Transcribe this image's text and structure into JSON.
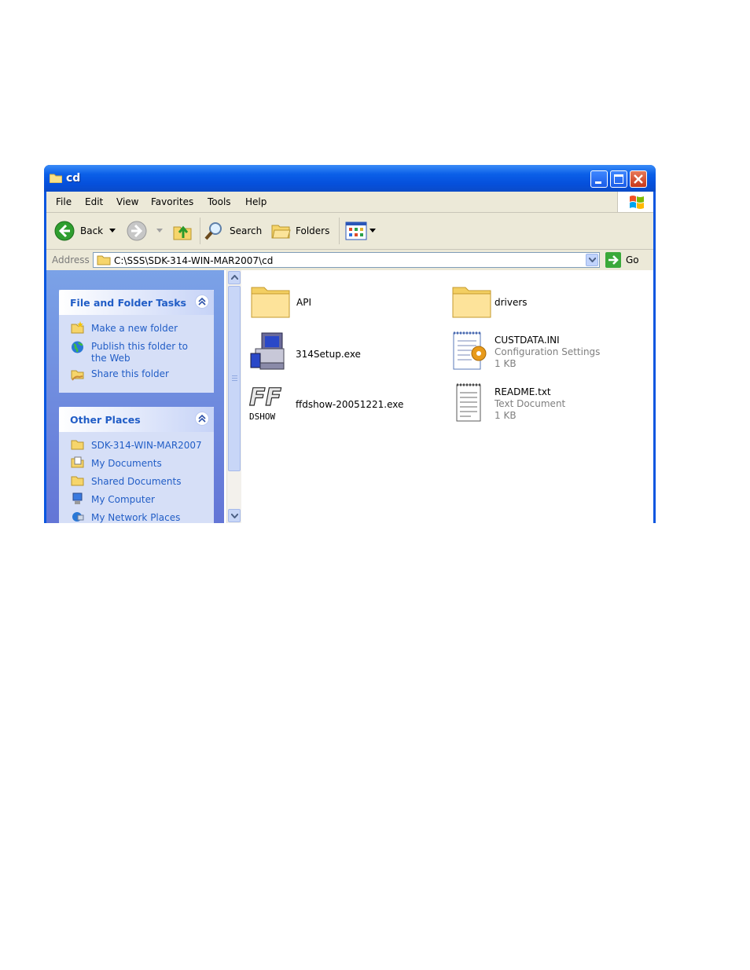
{
  "window": {
    "title": "cd",
    "controls": {
      "minimize": "minimize-button",
      "maximize": "maximize-button",
      "close": "close-button"
    }
  },
  "menubar": {
    "items": [
      {
        "label": "File"
      },
      {
        "label": "Edit"
      },
      {
        "label": "View"
      },
      {
        "label": "Favorites"
      },
      {
        "label": "Tools"
      },
      {
        "label": "Help"
      }
    ]
  },
  "toolbar": {
    "back_label": "Back",
    "search_label": "Search",
    "folders_label": "Folders"
  },
  "address": {
    "label": "Address",
    "value": "C:\\SSS\\SDK-314-WIN-MAR2007\\cd",
    "go_label": "Go"
  },
  "taskpane": {
    "file_tasks": {
      "title": "File and Folder Tasks",
      "items": [
        {
          "label": "Make a new folder",
          "icon": "new-folder-icon"
        },
        {
          "label": "Publish this folder to",
          "label2": "the Web",
          "icon": "globe-icon"
        },
        {
          "label": "Share this folder",
          "icon": "share-folder-icon"
        }
      ]
    },
    "other_places": {
      "title": "Other Places",
      "items": [
        {
          "label": "SDK-314-WIN-MAR2007",
          "icon": "folder-icon"
        },
        {
          "label": "My Documents",
          "icon": "my-documents-icon"
        },
        {
          "label": "Shared Documents",
          "icon": "folder-icon"
        },
        {
          "label": "My Computer",
          "icon": "computer-icon"
        },
        {
          "label": "My Network Places",
          "icon": "network-icon"
        }
      ]
    }
  },
  "files": [
    {
      "name": "API",
      "type": "folder"
    },
    {
      "name": "drivers",
      "type": "folder"
    },
    {
      "name": "314Setup.exe",
      "type": "installer"
    },
    {
      "name": "CUSTDATA.INI",
      "type": "config",
      "desc": "Configuration Settings",
      "size": "1 KB"
    },
    {
      "name": "ffdshow-20051221.exe",
      "type": "ffdshow",
      "logo_text": "DSHOW"
    },
    {
      "name": "README.txt",
      "type": "text",
      "desc": "Text Document",
      "size": "1 KB"
    }
  ],
  "colors": {
    "titlebar": "#0550dc",
    "taskpane_link": "#215dc6",
    "chrome": "#ece9d8"
  }
}
